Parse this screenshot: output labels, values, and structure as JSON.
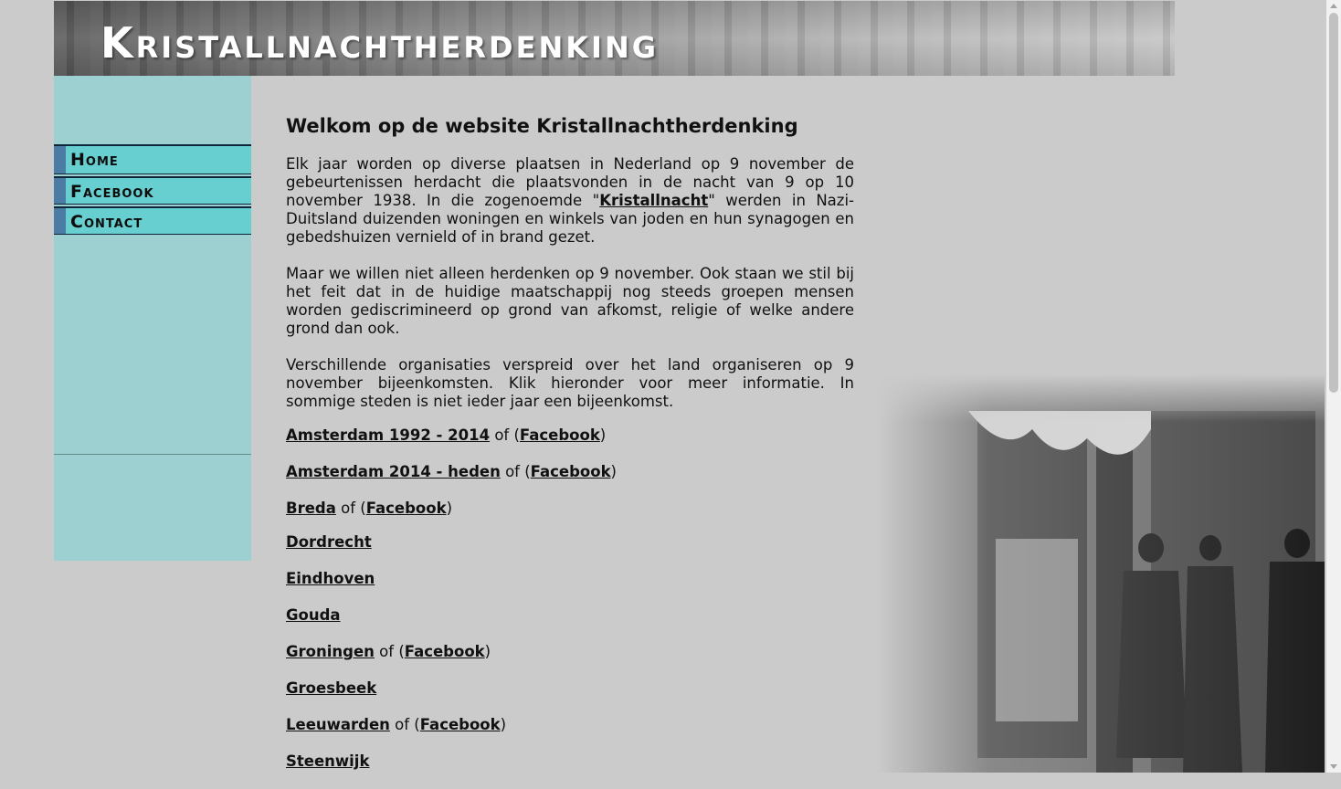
{
  "header": {
    "title": "Kristallnachtherdenking"
  },
  "nav": {
    "items": [
      {
        "label": "Home"
      },
      {
        "label": "Facebook"
      },
      {
        "label": "Contact"
      }
    ]
  },
  "main": {
    "heading": "Welkom op de website Kristallnachtherdenking",
    "p1_part1": "Elk jaar worden op diverse plaatsen in Nederland op 9 november de gebeurtenissen herdacht die plaatsvonden in de nacht van 9 op 10 november 1938. In die zogenoemde \"",
    "p1_link": "Kristallnacht",
    "p1_part2": "\" werden in Nazi-Duitsland duizenden woningen en winkels van joden en hun synagogen en gebedshuizen vernield of in brand gezet.",
    "p2": "Maar we willen niet alleen herdenken op 9 november. Ook staan we stil bij het feit dat in de huidige maatschappij nog steeds groepen mensen worden gediscrimineerd op grond van afkomst, religie of welke andere grond dan ook.",
    "p3": "Verschillende organisaties verspreid over het land organiseren op 9 november bijeenkomsten. Klik hieronder voor meer informatie. In sommige steden is niet ieder jaar een bijeenkomst.",
    "of_text": "of (",
    "close_paren": ")",
    "cities": [
      {
        "name": "Amsterdam 1992 - 2014",
        "facebook": "Facebook"
      },
      {
        "name": "Amsterdam 2014 - heden",
        "facebook": "Facebook"
      },
      {
        "name": "Breda",
        "facebook": "Facebook"
      },
      {
        "name": "Dordrecht"
      },
      {
        "name": "Eindhoven"
      },
      {
        "name": "Gouda"
      },
      {
        "name": "Groningen",
        "facebook": "Facebook"
      },
      {
        "name": "Groesbeek"
      },
      {
        "name": "Leeuwarden",
        "facebook": "Facebook"
      },
      {
        "name": "Steenwijk"
      }
    ]
  }
}
